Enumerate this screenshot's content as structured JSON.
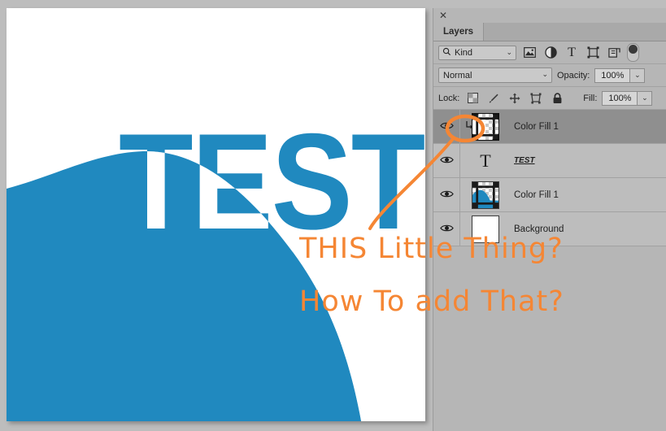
{
  "app": {
    "accent_orange": "#f58634",
    "brand_blue": "#2089bf",
    "panel_bg": "#b6b6b6",
    "row_bg": "#bdbdbd",
    "row_selected_bg": "#8f8f8f"
  },
  "canvas": {
    "artwork_text": "TEST",
    "wave_color": "#2089bf",
    "background_color": "#ffffff"
  },
  "panel": {
    "close_icon": "close-icon",
    "tab_label": "Layers",
    "filter_row": {
      "search_icon": "search-icon",
      "kind_label": "Kind",
      "chevron": "⌄",
      "icons": [
        {
          "name": "pixel-layer-filter-icon",
          "glyph": "image"
        },
        {
          "name": "adjustment-layer-filter-icon",
          "glyph": "half-circle"
        },
        {
          "name": "type-layer-filter-icon",
          "glyph": "T"
        },
        {
          "name": "shape-layer-filter-icon",
          "glyph": "shape"
        },
        {
          "name": "smart-object-filter-icon",
          "glyph": "smart-object"
        }
      ],
      "toggle_name": "filter-enable-toggle"
    },
    "blend_row": {
      "blend_mode": "Normal",
      "chevron": "⌄",
      "opacity_label": "Opacity:",
      "opacity_value": "100%",
      "opacity_stepper": "⌄"
    },
    "lock_row": {
      "lock_label": "Lock:",
      "lock_icons": [
        {
          "name": "lock-transparent-pixels-icon",
          "glyph": "checker"
        },
        {
          "name": "lock-image-pixels-icon",
          "glyph": "brush"
        },
        {
          "name": "lock-position-icon",
          "glyph": "move"
        },
        {
          "name": "lock-artboard-nesting-icon",
          "glyph": "artboard"
        },
        {
          "name": "lock-all-icon",
          "glyph": "padlock"
        }
      ],
      "fill_label": "Fill:",
      "fill_value": "100%",
      "fill_stepper": "⌄"
    },
    "layers": [
      {
        "name": "Color Fill 1",
        "selected": true,
        "visible": true,
        "clipped": true,
        "clip_indicator": "↳",
        "thumb_type": "solid-fill-clipped",
        "has_mask": true,
        "eye_icon": "eye-visible-icon"
      },
      {
        "name": "TEST",
        "selected": false,
        "visible": true,
        "clipped": false,
        "thumb_type": "type",
        "type_glyph": "T",
        "has_mask": false,
        "eye_icon": "eye-visible-icon"
      },
      {
        "name": "Color Fill 1",
        "selected": false,
        "visible": true,
        "clipped": false,
        "thumb_type": "solid-fill-wave",
        "has_mask": true,
        "eye_icon": "eye-visible-icon"
      },
      {
        "name": "Background",
        "selected": false,
        "visible": true,
        "clipped": false,
        "thumb_type": "white",
        "has_mask": false,
        "eye_icon": "eye-visible-icon"
      }
    ]
  },
  "annotation": {
    "color": "#f58634",
    "line1": "THIS Little Thing?",
    "line2": "How To add That?",
    "circle_target": "clipping-mask-indicator",
    "pointer": "leader-line"
  }
}
